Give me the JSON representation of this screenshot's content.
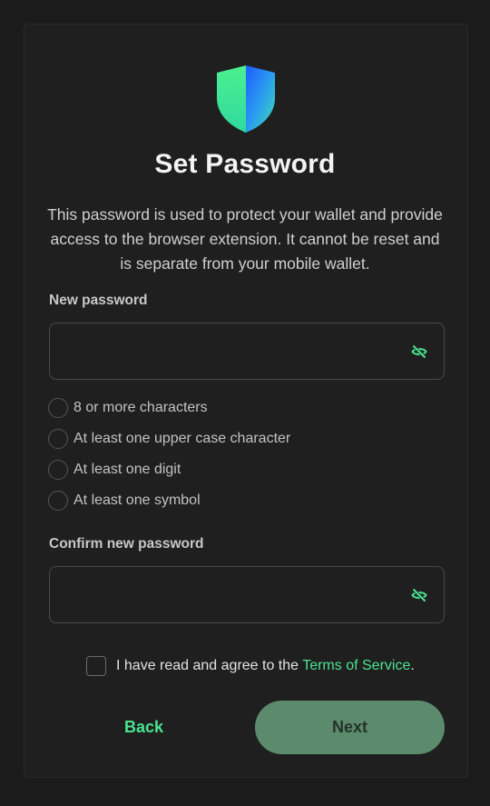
{
  "header": {
    "title": "Set Password",
    "description": "This password is used to protect your wallet and provide access to the browser extension. It cannot be reset and is separate from your mobile wallet."
  },
  "new_password": {
    "label": "New password",
    "value": "",
    "placeholder": "",
    "toggle_icon": "eye-off-icon"
  },
  "requirements": [
    {
      "label": "8 or more characters",
      "met": false
    },
    {
      "label": "At least one upper case character",
      "met": false
    },
    {
      "label": "At least one digit",
      "met": false
    },
    {
      "label": "At least one symbol",
      "met": false
    }
  ],
  "confirm_password": {
    "label": "Confirm new password",
    "value": "",
    "placeholder": "",
    "toggle_icon": "eye-off-icon"
  },
  "agreement": {
    "checked": false,
    "text": "I have read and agree to the ",
    "link_text": "Terms of Service",
    "suffix": "."
  },
  "actions": {
    "back_label": "Back",
    "next_label": "Next"
  },
  "colors": {
    "accent": "#4be391",
    "next_button_bg": "#5c8a6c",
    "background": "#1b1b1b"
  }
}
